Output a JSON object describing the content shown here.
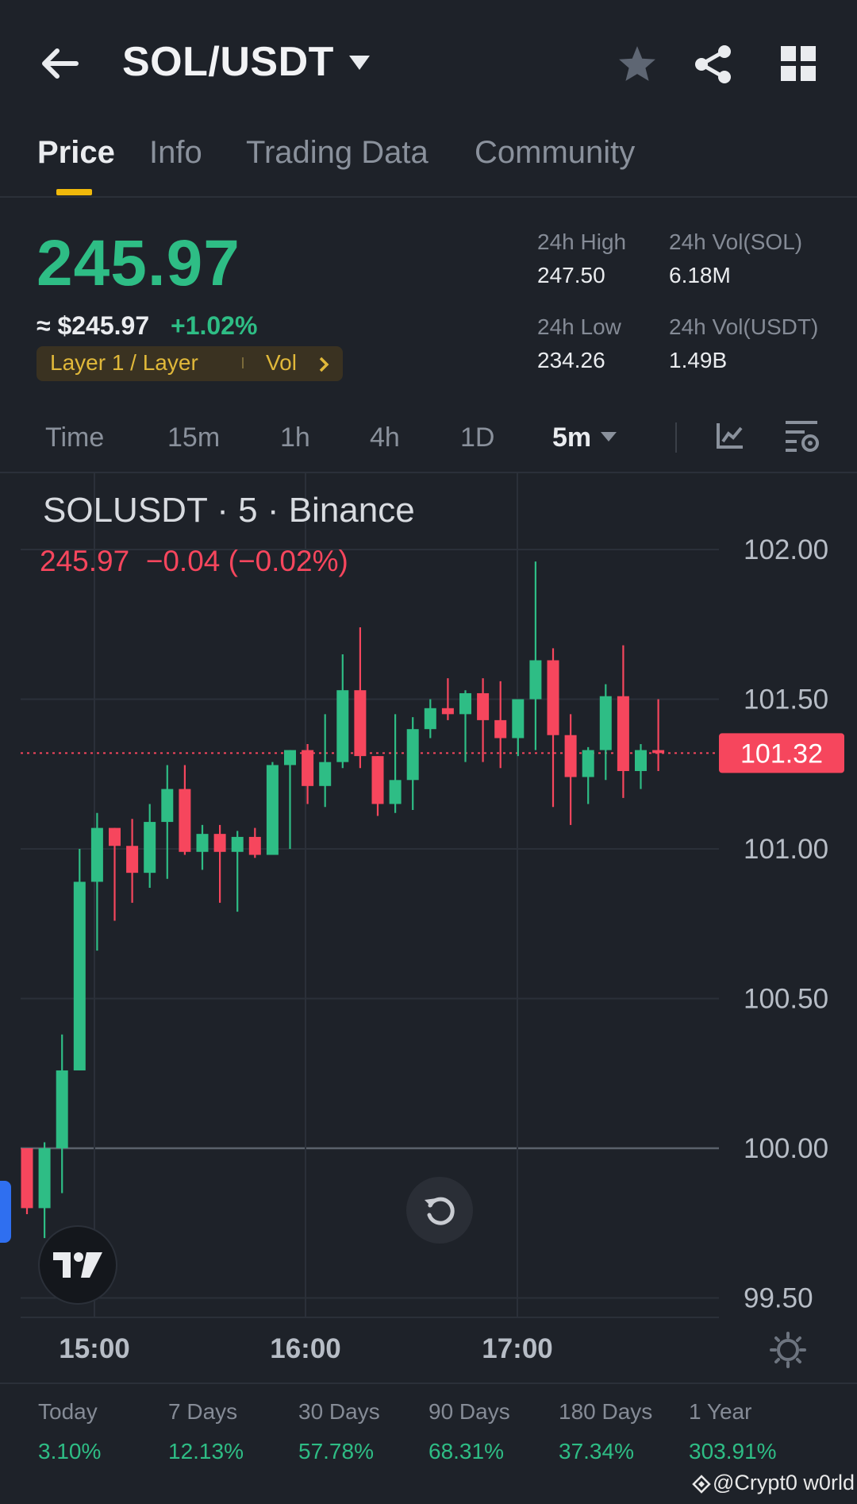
{
  "header": {
    "pair": "SOL/USDT",
    "icons": [
      "back-arrow-icon",
      "caret-down-icon",
      "star-icon",
      "share-icon",
      "grid-icon"
    ]
  },
  "tabs": [
    "Price",
    "Info",
    "Trading Data",
    "Community"
  ],
  "price": {
    "last": "245.97",
    "fiat": "≈ $245.97",
    "change_pct": "+1.02%",
    "tag_sector": "Layer 1 / Layer",
    "tag_vol": "Vol"
  },
  "stats": {
    "high_label": "24h High",
    "high_value": "247.50",
    "vol_sol_label": "24h Vol(SOL)",
    "vol_sol_value": "6.18M",
    "low_label": "24h Low",
    "low_value": "234.26",
    "vol_usdt_label": "24h Vol(USDT)",
    "vol_usdt_value": "1.49B"
  },
  "timeframes": [
    "Time",
    "15m",
    "1h",
    "4h",
    "1D",
    "5m"
  ],
  "timeframe_active": "5m",
  "chart_header": {
    "symbol_line": "SOLUSDT · 5 · Binance",
    "last": "245.97",
    "change": "−0.04 (−0.02%)"
  },
  "colors": {
    "up": "#2ebd85",
    "down": "#f6465d",
    "accent": "#f0b90b",
    "background": "#1e2229"
  },
  "chart_data": {
    "type": "candlestick",
    "y_ticks": [
      "102.00",
      "101.50",
      "101.00",
      "100.50",
      "100.00",
      "99.50"
    ],
    "ylim": [
      99.4,
      102.1
    ],
    "x_ticks": [
      "15:00",
      "16:00",
      "17:00"
    ],
    "current_price_label": "101.32",
    "current_price": 101.32,
    "candles": [
      {
        "o": 100.0,
        "h": 100.0,
        "l": 99.78,
        "c": 99.8
      },
      {
        "o": 99.8,
        "h": 100.02,
        "l": 99.7,
        "c": 100.0
      },
      {
        "o": 100.0,
        "h": 100.38,
        "l": 99.85,
        "c": 100.26
      },
      {
        "o": 100.26,
        "h": 101.0,
        "l": 100.26,
        "c": 100.89
      },
      {
        "o": 100.89,
        "h": 101.12,
        "l": 100.66,
        "c": 101.07
      },
      {
        "o": 101.07,
        "h": 101.07,
        "l": 100.76,
        "c": 101.01
      },
      {
        "o": 101.01,
        "h": 101.1,
        "l": 100.82,
        "c": 100.92
      },
      {
        "o": 100.92,
        "h": 101.15,
        "l": 100.87,
        "c": 101.09
      },
      {
        "o": 101.09,
        "h": 101.28,
        "l": 100.9,
        "c": 101.2
      },
      {
        "o": 101.2,
        "h": 101.28,
        "l": 100.98,
        "c": 100.99
      },
      {
        "o": 100.99,
        "h": 101.08,
        "l": 100.93,
        "c": 101.05
      },
      {
        "o": 101.05,
        "h": 101.08,
        "l": 100.82,
        "c": 100.99
      },
      {
        "o": 100.99,
        "h": 101.06,
        "l": 100.79,
        "c": 101.04
      },
      {
        "o": 101.04,
        "h": 101.07,
        "l": 100.97,
        "c": 100.98
      },
      {
        "o": 100.98,
        "h": 101.29,
        "l": 100.98,
        "c": 101.28
      },
      {
        "o": 101.28,
        "h": 101.33,
        "l": 101.0,
        "c": 101.33
      },
      {
        "o": 101.33,
        "h": 101.35,
        "l": 101.15,
        "c": 101.21
      },
      {
        "o": 101.21,
        "h": 101.45,
        "l": 101.14,
        "c": 101.29
      },
      {
        "o": 101.29,
        "h": 101.65,
        "l": 101.27,
        "c": 101.53
      },
      {
        "o": 101.53,
        "h": 101.74,
        "l": 101.27,
        "c": 101.31
      },
      {
        "o": 101.31,
        "h": 101.31,
        "l": 101.11,
        "c": 101.15
      },
      {
        "o": 101.15,
        "h": 101.45,
        "l": 101.12,
        "c": 101.23
      },
      {
        "o": 101.23,
        "h": 101.44,
        "l": 101.13,
        "c": 101.4
      },
      {
        "o": 101.4,
        "h": 101.5,
        "l": 101.37,
        "c": 101.47
      },
      {
        "o": 101.47,
        "h": 101.57,
        "l": 101.43,
        "c": 101.45
      },
      {
        "o": 101.45,
        "h": 101.53,
        "l": 101.29,
        "c": 101.52
      },
      {
        "o": 101.52,
        "h": 101.57,
        "l": 101.29,
        "c": 101.43
      },
      {
        "o": 101.43,
        "h": 101.56,
        "l": 101.27,
        "c": 101.37
      },
      {
        "o": 101.37,
        "h": 101.5,
        "l": 101.31,
        "c": 101.5
      },
      {
        "o": 101.5,
        "h": 101.96,
        "l": 101.33,
        "c": 101.63
      },
      {
        "o": 101.63,
        "h": 101.67,
        "l": 101.14,
        "c": 101.38
      },
      {
        "o": 101.38,
        "h": 101.45,
        "l": 101.08,
        "c": 101.24
      },
      {
        "o": 101.24,
        "h": 101.34,
        "l": 101.15,
        "c": 101.33
      },
      {
        "o": 101.33,
        "h": 101.55,
        "l": 101.23,
        "c": 101.51
      },
      {
        "o": 101.51,
        "h": 101.68,
        "l": 101.17,
        "c": 101.26
      },
      {
        "o": 101.26,
        "h": 101.35,
        "l": 101.2,
        "c": 101.33
      },
      {
        "o": 101.33,
        "h": 101.5,
        "l": 101.26,
        "c": 101.32
      }
    ]
  },
  "returns": [
    {
      "label": "Today",
      "value": "3.10%"
    },
    {
      "label": "7 Days",
      "value": "12.13%"
    },
    {
      "label": "30 Days",
      "value": "57.78%"
    },
    {
      "label": "90 Days",
      "value": "68.31%"
    },
    {
      "label": "180 Days",
      "value": "37.34%"
    },
    {
      "label": "1 Year",
      "value": "303.91%"
    }
  ],
  "watermark": "@Crypt0 w0rld"
}
